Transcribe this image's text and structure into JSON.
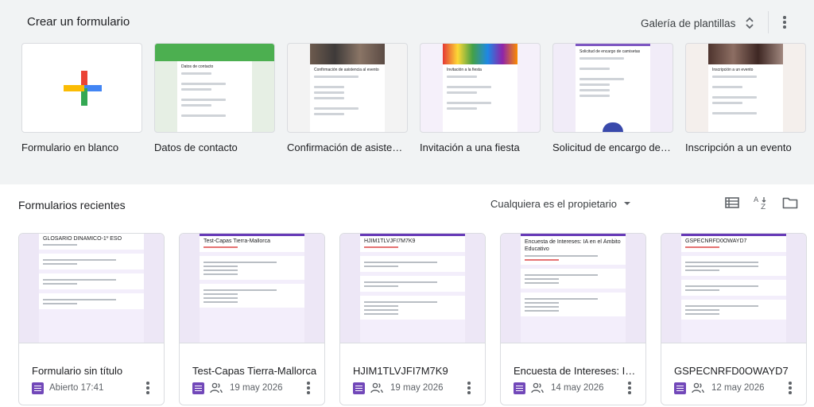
{
  "gallery": {
    "title": "Crear un formulario",
    "gallery_button": "Galería de plantillas",
    "templates": [
      {
        "label": "Formulario en blanco"
      },
      {
        "label": "Datos de contacto",
        "thumb_title": "Datos de contacto",
        "accent": "#43a047"
      },
      {
        "label": "Confirmación de asiste…",
        "thumb_title": "Confirmación de asistencia al evento",
        "accent": "#5f6368"
      },
      {
        "label": "Invitación a una fiesta",
        "thumb_title": "Invitación a la fiesta",
        "accent": "#ab47bc"
      },
      {
        "label": "Solicitud de encargo de…",
        "thumb_title": "Solicitud de encargo de camisetas",
        "accent": "#7e57c2"
      },
      {
        "label": "Inscripción a un evento",
        "thumb_title": "Inscripción a un evento",
        "accent": "#8d6e63"
      }
    ]
  },
  "recent": {
    "title": "Formularios recientes",
    "owner_filter": "Cualquiera es el propietario",
    "forms": [
      {
        "title": "Formulario sin título",
        "thumb_title": "GLOSARIO DINÁMICO-1º ESO",
        "meta": "Abierto 17:41",
        "shared": false
      },
      {
        "title": "Test-Capas Tierra-Mallorca",
        "thumb_title": "Test-Capas Tierra-Mallorca",
        "meta": "19 may 2026",
        "shared": true
      },
      {
        "title": "HJIM1TLVJFI7M7K9",
        "thumb_title": "HJIM1TLVJFI7M7K9",
        "meta": "19 may 2026",
        "shared": true
      },
      {
        "title": "Encuesta de Intereses: IA ...",
        "thumb_title": "Encuesta de Intereses: IA en el Ámbito Educativo",
        "meta": "14 may 2026",
        "shared": true
      },
      {
        "title": "GSPECNRFD0OWAYD7",
        "thumb_title": "GSPECNRFD0OWAYD7",
        "meta": "12 may 2026",
        "shared": true
      }
    ]
  },
  "colors": {
    "forms_purple": "#7248b9",
    "form_header": "#673ab7",
    "gallery_bg": "#f1f3f4"
  }
}
